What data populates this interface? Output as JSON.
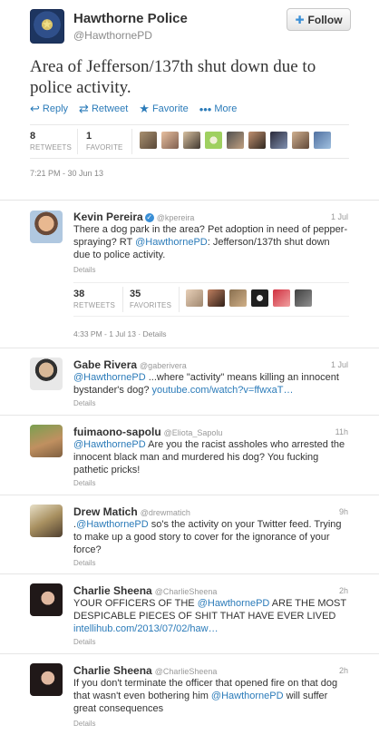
{
  "main_tweet": {
    "author_name": "Hawthorne Police",
    "author_handle": "@HawthornePD",
    "follow_label": "Follow",
    "text": "Area of Jefferson/137th shut down due to police activity.",
    "actions": {
      "reply": "Reply",
      "retweet": "Retweet",
      "favorite": "Favorite",
      "more": "More"
    },
    "retweets_count": "8",
    "retweets_label": "RETWEETS",
    "favorites_count": "1",
    "favorites_label": "FAVORITE",
    "timestamp": "7:21 PM - 30 Jun 13"
  },
  "replies": [
    {
      "name": "Kevin Pereira",
      "handle": "@kpereira",
      "time": "1 Jul",
      "text_pre": "There a dog park in the area? Pet adoption in need of pepper-spraying? RT ",
      "mention": "@HawthornePD",
      "text_post": ": Jefferson/137th shut down due to police activity.",
      "details": "Details",
      "retweets_count": "38",
      "retweets_label": "RETWEETS",
      "favorites_count": "35",
      "favorites_label": "FAVORITES",
      "timestamp": "4:33 PM - 1 Jul 13 · Details"
    },
    {
      "name": "Gabe Rivera",
      "handle": "@gaberivera",
      "time": "1 Jul",
      "mention": "@HawthornePD",
      "text_post": " ...where \"activity\" means killing an innocent bystander's dog? ",
      "link": "youtube.com/watch?v=ffwxaT…",
      "details": "Details"
    },
    {
      "name": "fuimaono-sapolu",
      "handle": "@Eliota_Sapolu",
      "time": "11h",
      "mention": "@HawthornePD",
      "text_post": " Are you the racist assholes who arrested the innocent black man and murdered his dog? You fucking pathetic pricks!",
      "details": "Details"
    },
    {
      "name": "Drew Matich",
      "handle": "@drewmatich",
      "time": "9h",
      "text_pre": ".",
      "mention": "@HawthornePD",
      "text_post": " so's the activity on your Twitter feed. Trying to make up a good story to cover for the ignorance of your force?",
      "details": "Details"
    },
    {
      "name": "Charlie Sheena",
      "handle": "@CharlieSheena",
      "time": "2h",
      "text_pre": "YOUR OFFICERS OF THE ",
      "mention": "@HawthornePD",
      "text_post": " ARE THE MOST DESPICABLE PIECES OF SHIT THAT HAVE EVER LIVED ",
      "link": "intellihub.com/2013/07/02/haw…",
      "details": "Details"
    },
    {
      "name": "Charlie Sheena",
      "handle": "@CharlieSheena",
      "time": "2h",
      "text_pre": "If you don't terminate the officer that opened fire on that dog that wasn't even bothering him ",
      "mention": "@HawthornePD",
      "text_post": " will suffer great consequences",
      "details": "Details"
    }
  ],
  "colors": {
    "link": "#2b7bb9",
    "verified": "#3a8fd6",
    "muted": "#999999"
  },
  "icons": {
    "reply": "reply-arrow-icon",
    "retweet": "retweet-icon",
    "favorite": "star-icon",
    "more": "more-dots-icon",
    "follow": "bird-icon",
    "verified": "verified-badge-icon"
  }
}
